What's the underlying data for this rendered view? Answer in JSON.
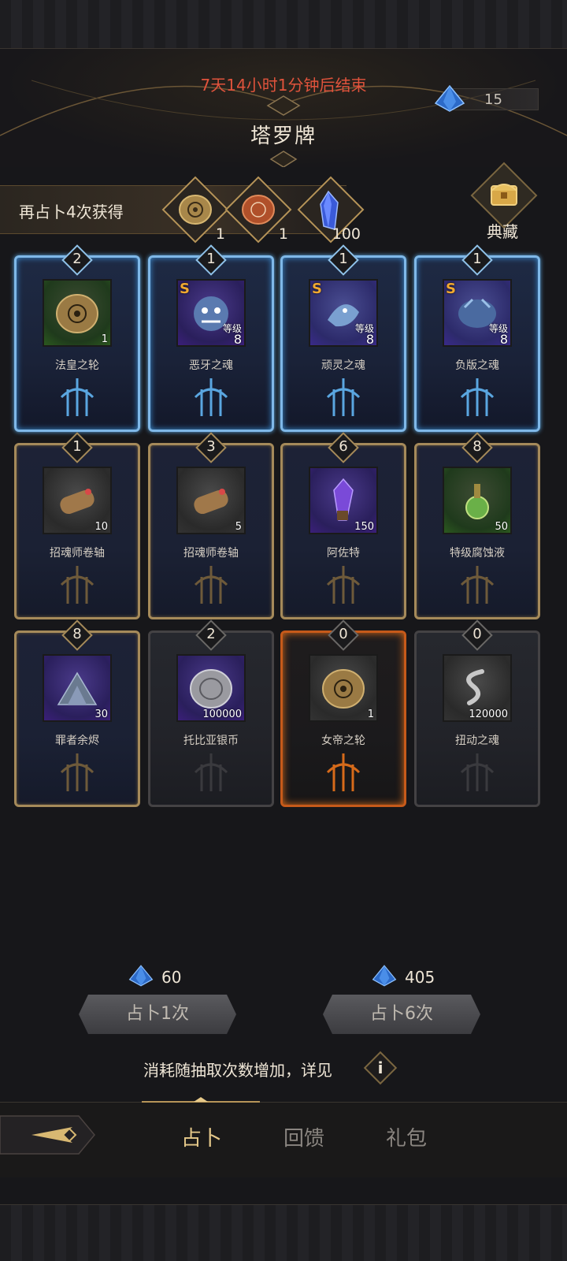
{
  "header": {
    "timer": "7天14小时1分钟后结束",
    "title": "塔罗牌",
    "gem_count": "15"
  },
  "reward": {
    "text": "再占卜4次获得",
    "items": [
      {
        "icon": "gold-wheel-coin-icon",
        "count": "1"
      },
      {
        "icon": "red-seal-coin-icon",
        "count": "1"
      },
      {
        "icon": "blue-crystal-icon",
        "count": "100"
      }
    ]
  },
  "collection": {
    "label": "典藏"
  },
  "cards": [
    {
      "frame": "blue",
      "badge": "2",
      "quality": "green",
      "icon": "wheel-coin-icon",
      "count": "1",
      "name": "法皇之轮"
    },
    {
      "frame": "blue",
      "badge": "1",
      "quality": "purple",
      "icon": "demon-soul-icon",
      "s": "S",
      "level_label": "等级",
      "level": "8",
      "name": "恶牙之魂"
    },
    {
      "frame": "blue",
      "badge": "1",
      "quality": "blue",
      "icon": "spirit-soul-icon",
      "s": "S",
      "level_label": "等级",
      "level": "8",
      "name": "顽灵之魂"
    },
    {
      "frame": "blue",
      "badge": "1",
      "quality": "blue",
      "icon": "beast-soul-icon",
      "s": "S",
      "level_label": "等级",
      "level": "8",
      "name": "负版之魂"
    },
    {
      "frame": "gold",
      "badge": "1",
      "quality": "grey",
      "icon": "scroll-icon",
      "count": "10",
      "name": "招魂师卷轴"
    },
    {
      "frame": "gold",
      "badge": "3",
      "quality": "grey",
      "icon": "scroll-icon",
      "count": "5",
      "name": "招魂师卷轴"
    },
    {
      "frame": "gold",
      "badge": "6",
      "quality": "purple",
      "icon": "crystal-vial-icon",
      "count": "150",
      "name": "阿佐特"
    },
    {
      "frame": "gold",
      "badge": "8",
      "quality": "green",
      "icon": "potion-icon",
      "count": "50",
      "name": "特级腐蚀液"
    },
    {
      "frame": "gold",
      "badge": "8",
      "quality": "purple",
      "icon": "ember-pile-icon",
      "count": "30",
      "name": "罪者余烬"
    },
    {
      "frame": "grey",
      "badge": "2",
      "quality": "purple",
      "icon": "silver-coin-icon",
      "count": "100000",
      "name": "托比亚银币"
    },
    {
      "frame": "fire",
      "badge": "0",
      "quality": "grey",
      "icon": "wheel-coin-icon",
      "count": "1",
      "name": "女帝之轮"
    },
    {
      "frame": "grey",
      "badge": "0",
      "quality": "grey",
      "icon": "twisted-soul-icon",
      "count": "120000",
      "name": "扭动之魂"
    }
  ],
  "draw": {
    "single_cost": "60",
    "single_label": "占卜1次",
    "multi_cost": "405",
    "multi_label": "占卜6次"
  },
  "notice": {
    "text": "消耗随抽取次数增加，详见",
    "info_label": "i"
  },
  "nav": {
    "tabs": [
      "占卜",
      "回馈",
      "礼包"
    ],
    "active": "占卜"
  },
  "colors": {
    "timer": "#e0533c",
    "active_tab": "#e6c98a",
    "blue_frame": "#7fb8e8",
    "gold_frame": "#a58a5a",
    "fire_frame": "#c65a1a"
  }
}
